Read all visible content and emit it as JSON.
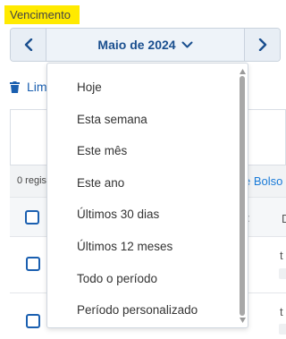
{
  "filter": {
    "label": "Vencimento",
    "month": "Maio de 2024"
  },
  "background": {
    "clear_label": "Lim",
    "records_text": "0 regis",
    "pocket_link": "e Bolso",
    "frag_colon": ":",
    "frag_d": "D",
    "frag_t1": "t",
    "frag_t2": "t"
  },
  "dropdown": {
    "options": [
      "Hoje",
      "Esta semana",
      "Este mês",
      "Este ano",
      "Últimos 30 dias",
      "Últimos 12 meses",
      "Todo o período",
      "Período personalizado"
    ]
  },
  "colors": {
    "highlight": "#ffea00",
    "accent": "#1a4f8f",
    "link": "#1a5fb0"
  }
}
